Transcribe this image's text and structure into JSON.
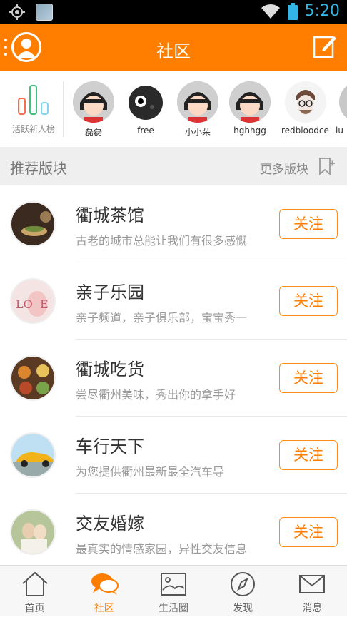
{
  "status_bar": {
    "time": "5:20"
  },
  "header": {
    "title": "社区"
  },
  "active_users": {
    "rank_label": "活跃新人榜",
    "users": [
      {
        "name": "磊磊"
      },
      {
        "name": "free"
      },
      {
        "name": "小小朵"
      },
      {
        "name": "hghhgg"
      },
      {
        "name": "redbloodcell"
      },
      {
        "name": "lu"
      }
    ]
  },
  "section": {
    "title": "推荐版块",
    "more_label": "更多版块"
  },
  "boards": [
    {
      "name": "衢城茶馆",
      "desc": "古老的城市总能让我们有很多感慨",
      "follow_label": "关注"
    },
    {
      "name": "亲子乐园",
      "desc": "亲子频道，亲子俱乐部，宝宝秀一",
      "follow_label": "关注"
    },
    {
      "name": "衢城吃货",
      "desc": "尝尽衢州美味，秀出你的拿手好",
      "follow_label": "关注"
    },
    {
      "name": "车行天下",
      "desc": "为您提供衢州最新最全汽车导",
      "follow_label": "关注"
    },
    {
      "name": "交友婚嫁",
      "desc": "最真实的情感家园，异性交友信息",
      "follow_label": "关注"
    }
  ],
  "tabs": [
    {
      "label": "首页",
      "icon": "home-icon",
      "active": false
    },
    {
      "label": "社区",
      "icon": "community-chat-icon",
      "active": true
    },
    {
      "label": "生活圈",
      "icon": "picture-frame-icon",
      "active": false
    },
    {
      "label": "发现",
      "icon": "compass-icon",
      "active": false
    },
    {
      "label": "消息",
      "icon": "envelope-icon",
      "active": false
    }
  ],
  "colors": {
    "brand": "#ff7e00",
    "status_time": "#33b5e5"
  }
}
